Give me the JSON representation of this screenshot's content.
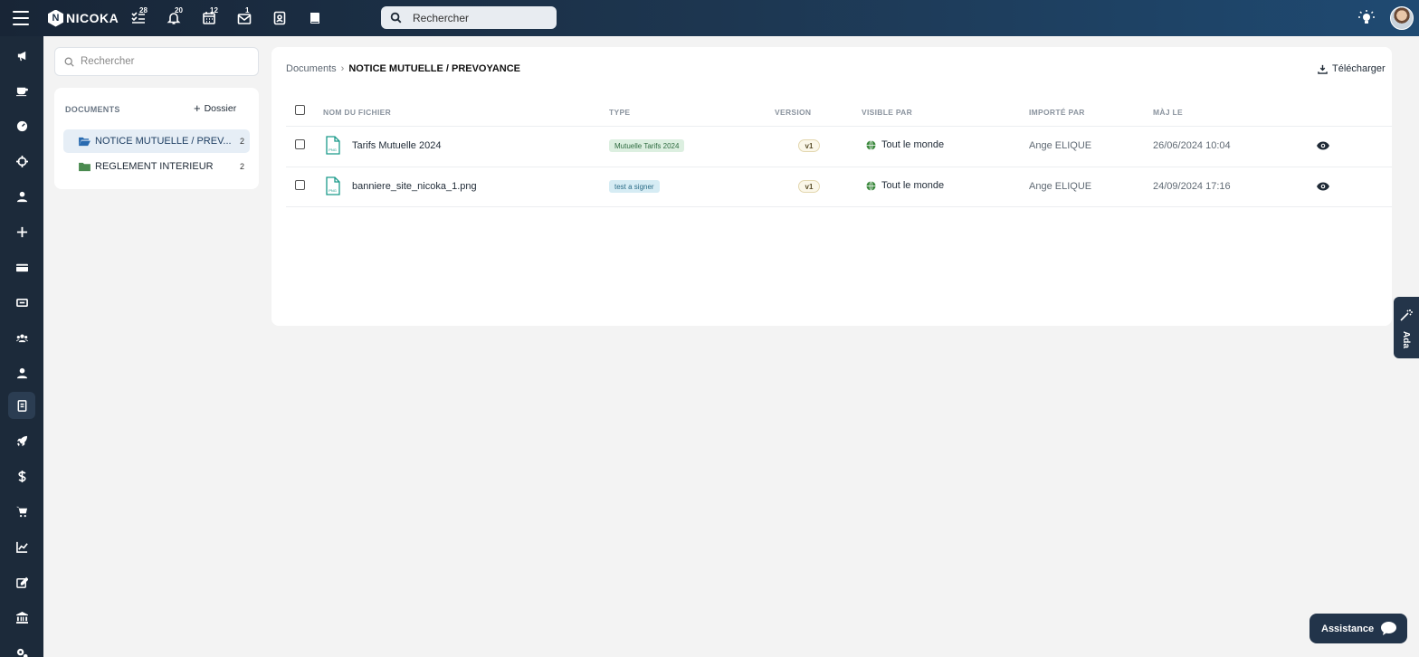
{
  "topbar": {
    "logo_letter": "N",
    "logo_text": "NICOKA",
    "search_placeholder": "Rechercher",
    "badges": {
      "tasks": "28",
      "notifications": "20",
      "calendar": "12",
      "mail": "1"
    }
  },
  "side": {
    "search_placeholder": "Rechercher",
    "heading": "DOCUMENTS",
    "add_folder_label": "Dossier",
    "folders": [
      {
        "label": "NOTICE MUTUELLE / PREV...",
        "count": "2",
        "active": true
      },
      {
        "label": "REGLEMENT INTERIEUR",
        "count": "2",
        "active": false
      }
    ]
  },
  "main": {
    "breadcrumb": {
      "root": "Documents",
      "current": "NOTICE MUTUELLE / PREVOYANCE"
    },
    "download_label": "Télécharger",
    "columns": {
      "name": "NOM DU FICHIER",
      "type": "TYPE",
      "version": "VERSION",
      "visible": "VISIBLE PAR",
      "imported": "IMPORTÉ PAR",
      "updated": "MÀJ LE"
    },
    "rows": [
      {
        "name": "Tarifs Mutuelle 2024",
        "type": "Mutuelle Tarifs 2024",
        "type_color": "green",
        "version": "v1",
        "visible": "Tout le monde",
        "imported": "Ange ELIQUE",
        "updated": "26/06/2024 10:04"
      },
      {
        "name": "banniere_site_nicoka_1.png",
        "type": "test a signer",
        "type_color": "blue",
        "version": "v1",
        "visible": "Tout le monde",
        "imported": "Ange ELIQUE",
        "updated": "24/09/2024 17:16"
      }
    ]
  },
  "ada_label": "Ada",
  "assistance_label": "Assistance",
  "colors": {
    "topbar": "#1d3650",
    "rail": "#1c2a3a",
    "accent": "#1f3f63"
  }
}
